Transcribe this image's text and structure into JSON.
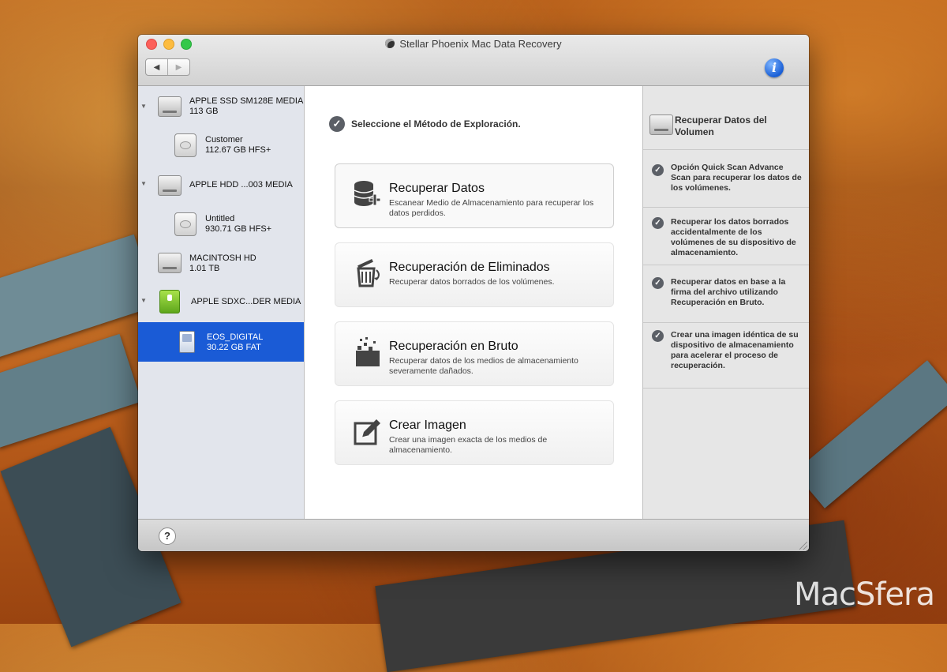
{
  "window": {
    "title": "Stellar Phoenix Mac Data Recovery"
  },
  "toolbar": {
    "back_icon": "◀",
    "forward_icon": "▶",
    "info_icon": "i"
  },
  "sidebar": {
    "drives": [
      {
        "name": "APPLE SSD SM128E MEDIA",
        "size": "113  GB"
      },
      {
        "name": "Customer",
        "size": "112.67 GB HFS+"
      },
      {
        "name": "APPLE HDD ...003 MEDIA",
        "size": ""
      },
      {
        "name": "Untitled",
        "size": "930.71 GB HFS+"
      },
      {
        "name": "MACINTOSH HD",
        "size": "1.01 TB"
      },
      {
        "name": "APPLE SDXC...DER MEDIA",
        "size": ""
      },
      {
        "name": "EOS_DIGITAL",
        "size": "30.22 GB FAT"
      }
    ],
    "selected_index": 6
  },
  "main": {
    "header": "Seleccione el Método de Exploración.",
    "options": [
      {
        "title": "Recuperar Datos",
        "description": "Escanear Medio de Almacenamiento para recuperar los datos perdidos.",
        "icon": "database-plus-icon"
      },
      {
        "title": "Recuperación de Eliminados",
        "description": "Recuperar datos borrados de los volúmenes.",
        "icon": "trash-restore-icon"
      },
      {
        "title": "Recuperación en Bruto",
        "description": "Recuperar datos de los medios de almacenamiento severamente dañados.",
        "icon": "raw-blocks-icon"
      },
      {
        "title": "Crear Imagen",
        "description": "Crear una imagen exacta de los medios de almacenamiento.",
        "icon": "edit-image-icon"
      }
    ]
  },
  "right_panel": {
    "title": "Recuperar Datos del Volumen",
    "items": [
      "Opción Quick Scan Advance Scan para recuperar los datos de los volúmenes.",
      "Recuperar los datos borrados accidentalmente de los volúmenes de su dispositivo de almacenamiento.",
      "Recuperar datos en base a la firma del archivo utilizando Recuperación en Bruto.",
      "Crear una imagen idéntica de su dispositivo de almacenamiento para acelerar el proceso de recuperación."
    ]
  },
  "bottom": {
    "help_label": "?"
  },
  "watermark": "MacSfera",
  "colors": {
    "selection": "#1a5bd6",
    "sidebar_bg": "#e2e5ec",
    "panel_bg": "#e6e6e6"
  }
}
